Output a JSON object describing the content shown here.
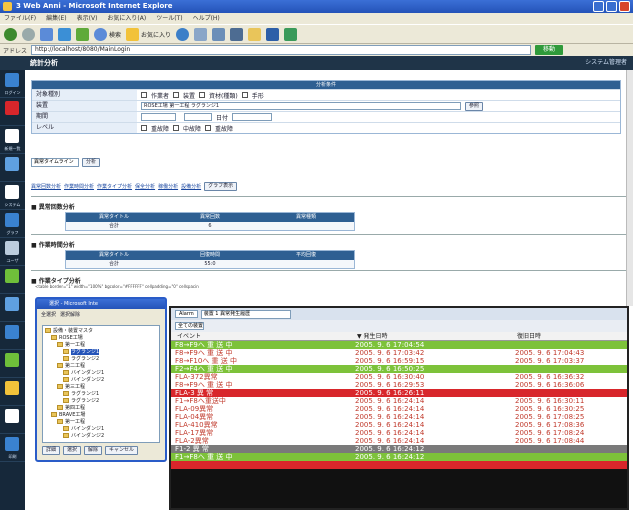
{
  "window": {
    "title": "3 Web Anni - Microsoft Internet Explore",
    "menu": [
      "ファイル(F)",
      "編集(E)",
      "表示(V)",
      "お気に入り(A)",
      "ツール(T)",
      "ヘルプ(H)"
    ],
    "address": "http://localhost/8080/MainLogin",
    "go_label": "移動",
    "toolbar_search": "検索",
    "toolbar_favorites": "お気に入り"
  },
  "app": {
    "header_title": "統計分析",
    "header_right": "システム管理者"
  },
  "nav": [
    "ログイン",
    "",
    "新規一覧",
    "",
    "システム",
    "グラフ",
    "ユーザ",
    "",
    "",
    "",
    "",
    "",
    "",
    "",
    "",
    "印刷"
  ],
  "form": {
    "header": "分析条件",
    "rows": [
      {
        "label": "対象種別",
        "values": [
          "作業者",
          "装置",
          "資材(種類)",
          "手形"
        ]
      },
      {
        "label": "装置",
        "value": "ROSE工場 第一工程 ラグランジ1",
        "button": "参照"
      },
      {
        "label": "期間",
        "from_label": "",
        "to_label": "日付"
      },
      {
        "label": "レベル",
        "values": [
          "重故障",
          "中故障",
          "重故障"
        ]
      }
    ],
    "select_value": "異常タイムライン",
    "submit": "分析"
  },
  "links": [
    "異常回数分析",
    "作業時間分析",
    "作業タイプ分析",
    "保全分析",
    "稼働分析",
    "設備分析"
  ],
  "links_button": "グラフ表示",
  "section1": {
    "title": "異常回数分析",
    "headers": [
      "異常タイトル",
      "異常回数",
      "異常種類"
    ],
    "row": [
      "合計",
      "6",
      ""
    ]
  },
  "section2": {
    "title": "作業時間分析",
    "headers": [
      "異常タイトル",
      "回復時間",
      "平均回復"
    ],
    "row": [
      "合計",
      "55:0",
      ""
    ]
  },
  "section3": {
    "title": "作業タイプ分析",
    "code": "<table border=\"1\" width=\"100%\" bgcolor=\"#FFFFFF\" cellpadding=\"0\" cellspacin"
  },
  "popup": {
    "title": "選択 - Microsoft Inte",
    "toolbar": [
      "全選択",
      "選択解除"
    ],
    "tree": [
      {
        "label": "設備・装置マスタ",
        "indent": 0
      },
      {
        "label": "ROSE工場",
        "indent": 1
      },
      {
        "label": "第一工程",
        "indent": 2
      },
      {
        "label": "ラグランジ1",
        "indent": 3,
        "selected": true
      },
      {
        "label": "ラグランジ2",
        "indent": 3
      },
      {
        "label": "第二工程",
        "indent": 2
      },
      {
        "label": "バインダンジ1",
        "indent": 3
      },
      {
        "label": "バインダンジ2",
        "indent": 3
      },
      {
        "label": "第三工程",
        "indent": 2
      },
      {
        "label": "ラグランジ1",
        "indent": 3
      },
      {
        "label": "ラグランジ2",
        "indent": 3
      },
      {
        "label": "第四工程",
        "indent": 2
      },
      {
        "label": "BRAVE工場",
        "indent": 1
      },
      {
        "label": "第一工程",
        "indent": 2
      },
      {
        "label": "バインダンジ1",
        "indent": 3
      },
      {
        "label": "バインダンジ2",
        "indent": 3
      },
      {
        "label": "バインダンジ3",
        "indent": 3
      }
    ],
    "buttons": [
      "詳細",
      "選択",
      "解除",
      "キャンセル"
    ]
  },
  "events": {
    "tab": "Alarm",
    "filter1": "装置 1 異常発生履歴",
    "filter2": "全ての装置",
    "headers": [
      "イベント",
      "▼ 発生日時",
      "復旧日時"
    ],
    "rows": [
      {
        "event": "F8→F9へ 重 送 中",
        "occurred": "2005. 9. 6 17:04:54",
        "restored": "",
        "bg": "#7dc23a",
        "fg": "#ffffff"
      },
      {
        "event": "F8→F9へ 重 送 中",
        "occurred": "2005. 9. 6 17:03:42",
        "restored": "2005. 9. 6 17:04:43",
        "bg": "#ffffff",
        "fg": "#c0392b"
      },
      {
        "event": "F8→F10へ 重 送 中",
        "occurred": "2005. 9. 6 16:59:15",
        "restored": "2005. 9. 6 17:03:37",
        "bg": "#ffffff",
        "fg": "#c0392b"
      },
      {
        "event": "F2→F4へ 重 送 中",
        "occurred": "2005. 9. 6 16:50:25",
        "restored": "",
        "bg": "#7dc23a",
        "fg": "#ffffff"
      },
      {
        "event": "FLA-372異常",
        "occurred": "2005. 9. 6 16:30:40",
        "restored": "2005. 9. 6 16:36:32",
        "bg": "#ffffff",
        "fg": "#c0392b"
      },
      {
        "event": "F8→F9へ 重 送 中",
        "occurred": "2005. 9. 6 16:29:53",
        "restored": "2005. 9. 6 16:36:06",
        "bg": "#ffffff",
        "fg": "#c0392b"
      },
      {
        "event": "FLA-3 異 常",
        "occurred": "2005. 9. 6 16:26:11",
        "restored": "",
        "bg": "#d8262b",
        "fg": "#ffffff"
      },
      {
        "event": "F1→F8へ重送中",
        "occurred": "2005. 9. 6 16:24:14",
        "restored": "2005. 9. 6 16:30:11",
        "bg": "#ffffff",
        "fg": "#c0392b"
      },
      {
        "event": "FLA-09異常",
        "occurred": "2005. 9. 6 16:24:14",
        "restored": "2005. 9. 6 16:30:25",
        "bg": "#ffffff",
        "fg": "#c0392b"
      },
      {
        "event": "FLA-04異常",
        "occurred": "2005. 9. 6 16:24:14",
        "restored": "2005. 9. 6 17:08:25",
        "bg": "#ffffff",
        "fg": "#c0392b"
      },
      {
        "event": "FLA-410異常",
        "occurred": "2005. 9. 6 16:24:14",
        "restored": "2005. 9. 6 17:08:36",
        "bg": "#ffffff",
        "fg": "#c0392b"
      },
      {
        "event": "FLA-17異常",
        "occurred": "2005. 9. 6 16:24:14",
        "restored": "2005. 9. 6 17:08:24",
        "bg": "#ffffff",
        "fg": "#c0392b"
      },
      {
        "event": "FLA-2異常",
        "occurred": "2005. 9. 6 16:24:14",
        "restored": "2005. 9. 6 17:08:44",
        "bg": "#ffffff",
        "fg": "#c0392b"
      },
      {
        "event": "F1-2 異 常",
        "occurred": "2005. 9. 6 16:24:12",
        "restored": "",
        "bg": "#7a7a7a",
        "fg": "#ffffff"
      },
      {
        "event": "F1→F8へ 重 送 中",
        "occurred": "2005. 9. 6 16:24:12",
        "restored": "",
        "bg": "#7dc23a",
        "fg": "#ffffff"
      },
      {
        "event": "",
        "occurred": "",
        "restored": "",
        "bg": "#d8262b",
        "fg": "#ffffff"
      }
    ]
  }
}
